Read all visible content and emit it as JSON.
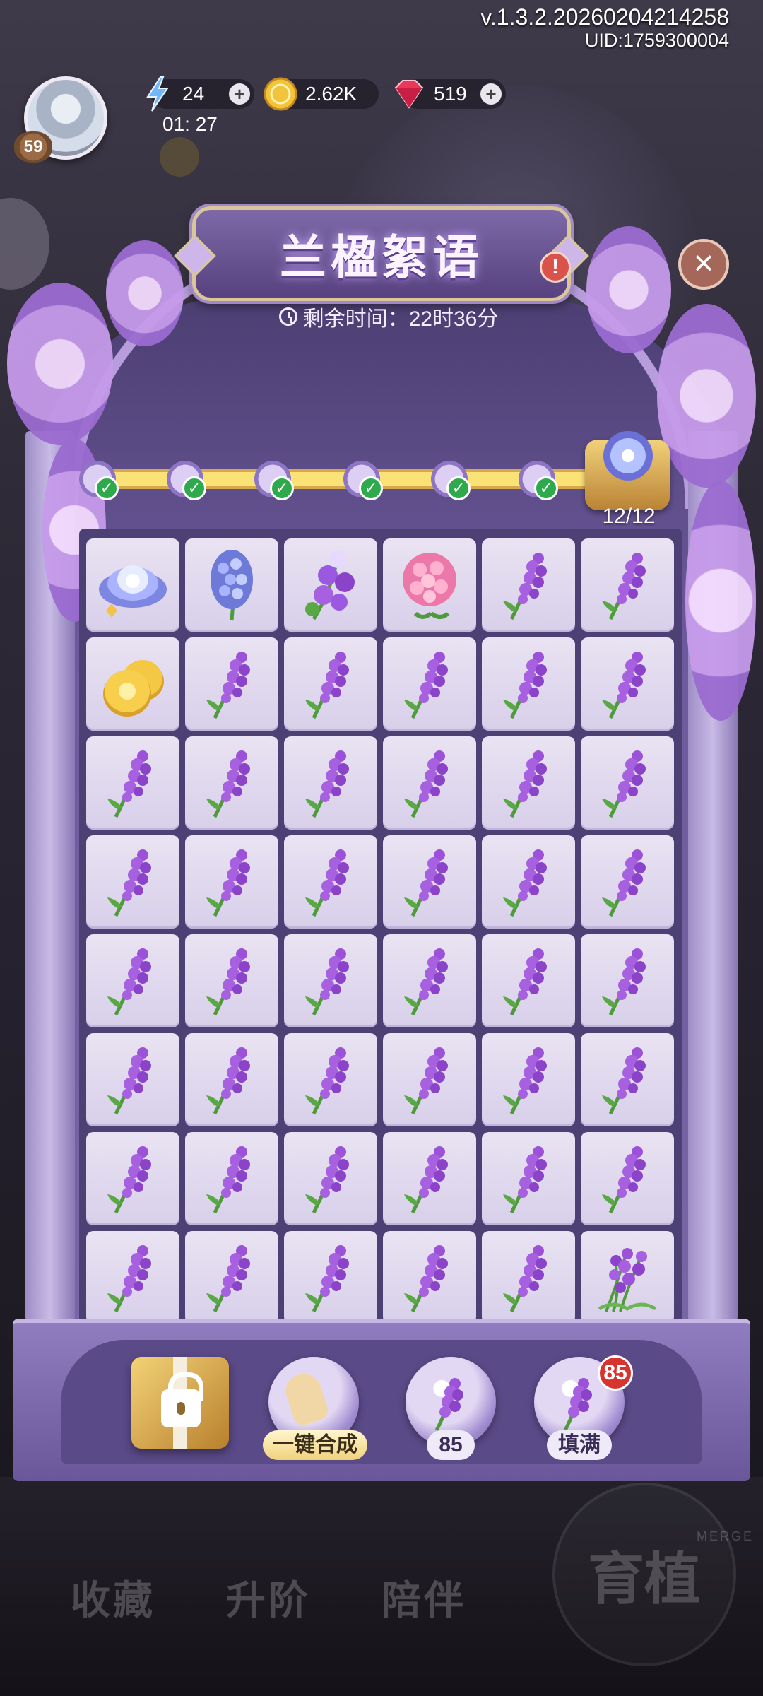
{
  "hud": {
    "version": "v.1.3.2.20260204214258",
    "uid": "UID:1759300004",
    "player_level": "59",
    "energy": "24",
    "energy_timer": "01: 27",
    "coins": "2.62K",
    "gems": "519"
  },
  "event": {
    "title": "兰楹絮语",
    "remaining_time": "剩余时间：22时36分",
    "progress": "12/12",
    "milestones_completed": 6
  },
  "board": {
    "rows": 8,
    "cols": 6,
    "cells": [
      "blue-lotus",
      "hyacinth",
      "purple-bellflower",
      "pink-hydrangea",
      "lavender",
      "lavender",
      "gold-coins",
      "lavender",
      "lavender",
      "lavender",
      "lavender",
      "lavender",
      "lavender",
      "lavender",
      "lavender",
      "lavender",
      "lavender",
      "lavender",
      "lavender",
      "lavender",
      "lavender",
      "lavender",
      "lavender",
      "lavender",
      "lavender",
      "lavender",
      "lavender",
      "lavender",
      "lavender",
      "lavender",
      "lavender",
      "lavender",
      "lavender",
      "lavender",
      "lavender",
      "lavender",
      "lavender",
      "lavender",
      "lavender",
      "lavender",
      "lavender",
      "lavender",
      "lavender",
      "lavender",
      "lavender",
      "lavender",
      "lavender",
      "lavender-bunch"
    ]
  },
  "actions": {
    "merge_all_label": "一键合成",
    "lavender_count": "85",
    "fill_label": "填满",
    "fill_badge": "85"
  },
  "nav": {
    "collect": "收藏",
    "upgrade": "升阶",
    "company": "陪伴",
    "grow": "育植",
    "merge": "MERGE"
  },
  "colors": {
    "accent": "#7a68a8",
    "progress": "#fbe277",
    "check": "#2ea94c",
    "badge": "#d8342f"
  }
}
